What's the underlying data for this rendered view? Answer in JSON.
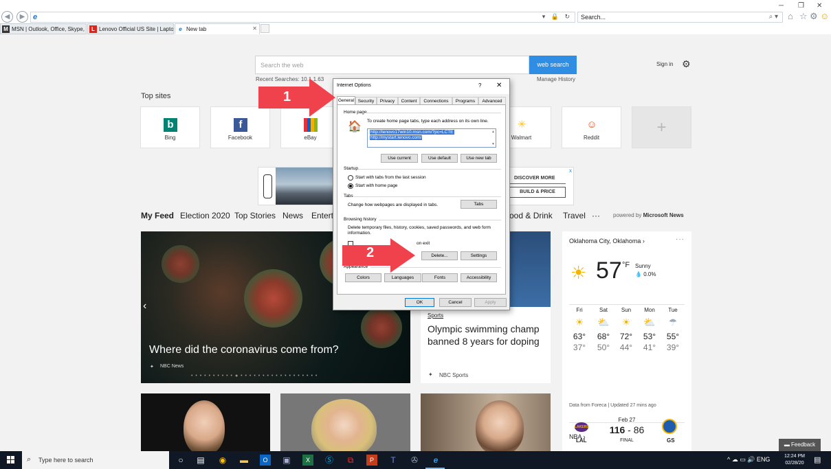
{
  "browser": {
    "address_value": "",
    "search_placeholder": "Search...",
    "tabs": [
      {
        "label": "MSN | Outlook, Office, Skype, ...",
        "favicon": "M",
        "favicon_color": "#333333"
      },
      {
        "label": "Lenovo Official US Site | Lapto...",
        "favicon": "L",
        "favicon_color": "#e2231a"
      },
      {
        "label": "New tab",
        "favicon": "e",
        "favicon_color": "#1e73c8",
        "active": true
      }
    ],
    "icons": [
      "back-icon",
      "forward-icon",
      "ie-icon",
      "search-icon",
      "home-icon",
      "star-icon",
      "gear-icon",
      "smiley-icon"
    ]
  },
  "page": {
    "search_placeholder": "Search the web",
    "search_button": "web search",
    "recent_searches": "Recent Searches:  10.1.1.63",
    "manage_history": "Manage History",
    "sign_in": "Sign in",
    "top_sites_title": "Top sites",
    "top_sites": [
      {
        "label": "Bing",
        "color": "#008373",
        "glyph": "b"
      },
      {
        "label": "Facebook",
        "color": "#3b5998",
        "glyph": "f"
      },
      {
        "label": "eBay",
        "color": "#333333",
        "glyph": "e"
      },
      {
        "label": "Walmart",
        "color": "#ffc220",
        "glyph": "✳"
      },
      {
        "label": "Reddit",
        "color": "#ff4500",
        "glyph": "☺"
      }
    ],
    "ad": {
      "cta1": "DISCOVER MORE",
      "cta2": "BUILD & PRICE",
      "close": "x"
    },
    "feed_nav": [
      "My Feed",
      "Election 2020",
      "Top Stories",
      "News",
      "Entert",
      "ood & Drink",
      "Travel",
      "···"
    ],
    "powered_by_prefix": "powered by",
    "powered_by_brand": "Microsoft News",
    "hero": {
      "title": "Where did the coronavirus come from?",
      "source": "NBC News",
      "dots": "• • • • • • • • • • ● • • • • • • • • • • • • • • • • • •"
    },
    "news_card": {
      "category": "Sports",
      "title": "Olympic swimming champ banned 8 years for doping",
      "source": "NBC Sports"
    },
    "weather": {
      "city": "Oklahoma City, Oklahoma  ›",
      "more": "···",
      "temp": "57",
      "unit": "°F",
      "condition": "Sunny",
      "precip": "0.0%",
      "forecast": [
        {
          "day": "Fri",
          "icon": "sun-icon",
          "hi": "63°",
          "lo": "37°"
        },
        {
          "day": "Sat",
          "icon": "partly-cloudy-icon",
          "hi": "68°",
          "lo": "50°"
        },
        {
          "day": "Sun",
          "icon": "sun-icon",
          "hi": "72°",
          "lo": "44°"
        },
        {
          "day": "Mon",
          "icon": "partly-cloudy-icon",
          "hi": "53°",
          "lo": "41°"
        },
        {
          "day": "Tue",
          "icon": "rain-icon",
          "hi": "55°",
          "lo": "39°"
        }
      ],
      "credit": "Data from Foreca | Updated 27 mins ago"
    },
    "nba": {
      "title": "NBA  ›",
      "date": "Feb 27",
      "home_score": "116",
      "away_score": "86",
      "status": "FINAL",
      "home": "LAL",
      "away": "GS"
    },
    "feedback": "Feedback"
  },
  "dialog": {
    "title": "Internet Options",
    "help": "?",
    "close": "✕",
    "tabs": [
      "General",
      "Security",
      "Privacy",
      "Content",
      "Connections",
      "Programs",
      "Advanced"
    ],
    "home_page": {
      "label": "Home page",
      "hint": "To create home page tabs, type each address on its own line.",
      "urls": [
        "http://lenovo17win10.msn.com/?pc=LCTE",
        "http://mystart.lenovo.com/"
      ],
      "use_current": "Use current",
      "use_default": "Use default",
      "use_new_tab": "Use new tab"
    },
    "startup": {
      "label": "Startup",
      "option1": "Start with tabs from the last session",
      "option2": "Start with home page"
    },
    "tabs_group": {
      "label": "Tabs",
      "text": "Change how webpages are displayed in tabs.",
      "button": "Tabs"
    },
    "browsing_history": {
      "label": "Browsing history",
      "text": "Delete temporary files, history, cookies, saved passwords, and web form information.",
      "checkbox_label": "on exit",
      "delete": "Delete...",
      "settings": "Settings"
    },
    "appearance": {
      "label": "Appearance",
      "colors": "Colors",
      "languages": "Languages",
      "fonts": "Fonts",
      "accessibility": "Accessibility"
    },
    "ok": "OK",
    "cancel": "Cancel",
    "apply": "Apply"
  },
  "annotations": {
    "arrow1_label": "1",
    "arrow2_label": "2",
    "arrow_color": "#f0424d"
  },
  "taskbar": {
    "search_placeholder": "Type here to search",
    "tray": "^  ☁  ▭  🔊  ENG",
    "time": "12:24 PM",
    "date": "02/28/20"
  }
}
